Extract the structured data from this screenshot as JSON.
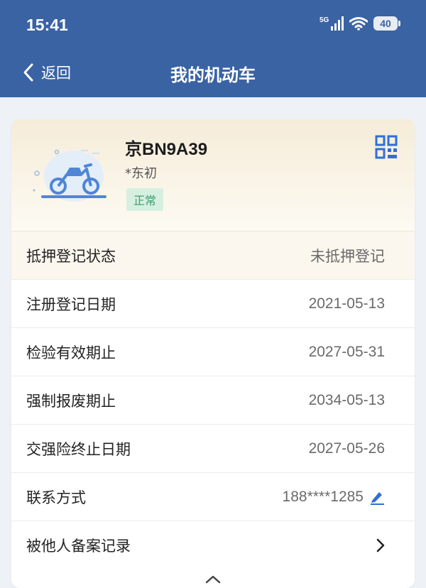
{
  "status_bar": {
    "time": "15:41",
    "network": "5G",
    "battery": "40"
  },
  "nav": {
    "back_label": "返回",
    "title": "我的机动车"
  },
  "vehicle": {
    "plate": "京BN9A39",
    "owner": "*东初",
    "status": "正常",
    "icon": "motorcycle-icon",
    "qr_icon": "qr-code-icon"
  },
  "rows": [
    {
      "label": "抵押登记状态",
      "value": "未抵押登记"
    },
    {
      "label": "注册登记日期",
      "value": "2021-05-13"
    },
    {
      "label": "检验有效期止",
      "value": "2027-05-31"
    },
    {
      "label": "强制报废期止",
      "value": "2034-05-13"
    },
    {
      "label": "交强险终止日期",
      "value": "2027-05-26"
    },
    {
      "label": "联系方式",
      "value": "188****1285"
    },
    {
      "label": "被他人备案记录",
      "value": ""
    }
  ],
  "colors": {
    "header": "#3a63a4",
    "badge_bg": "#d6efe1",
    "badge_text": "#3aa06b",
    "accent": "#2f6fd8"
  }
}
